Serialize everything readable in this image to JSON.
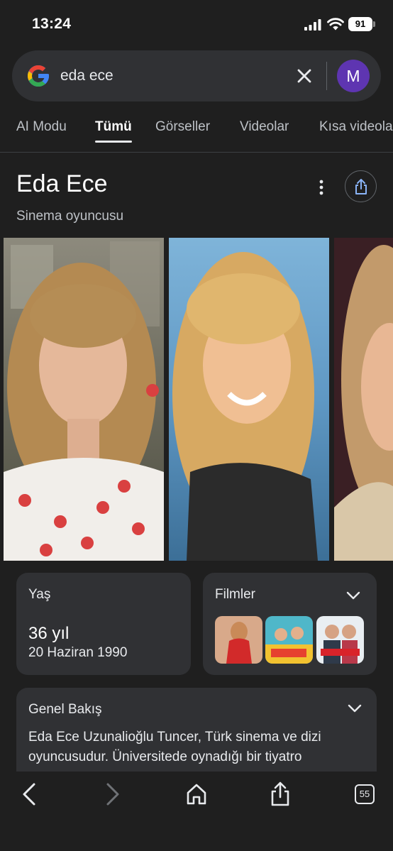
{
  "status": {
    "time": "13:24",
    "battery": "91"
  },
  "search": {
    "query": "eda ece",
    "avatar_letter": "M"
  },
  "tabs": [
    {
      "label": "AI Modu"
    },
    {
      "label": "Tümü"
    },
    {
      "label": "Görseller"
    },
    {
      "label": "Videolar"
    },
    {
      "label": "Kısa videolar"
    }
  ],
  "entity": {
    "title": "Eda Ece",
    "subtitle": "Sinema oyuncusu"
  },
  "age_card": {
    "label": "Yaş",
    "value": "36 yıl",
    "birth_date": "20 Haziran 1990"
  },
  "films_card": {
    "label": "Filmler"
  },
  "overview": {
    "label": "Genel Bakış",
    "text": "Eda Ece Uzunalioğlu Tuncer, Türk sinema ve dizi oyuncusudur. Üniversitede oynadığı bir tiyatro"
  },
  "browser": {
    "tab_count": "55"
  },
  "colors": {
    "background": "#1f1f1f",
    "card": "#303134",
    "avatar": "#5e35b1"
  }
}
